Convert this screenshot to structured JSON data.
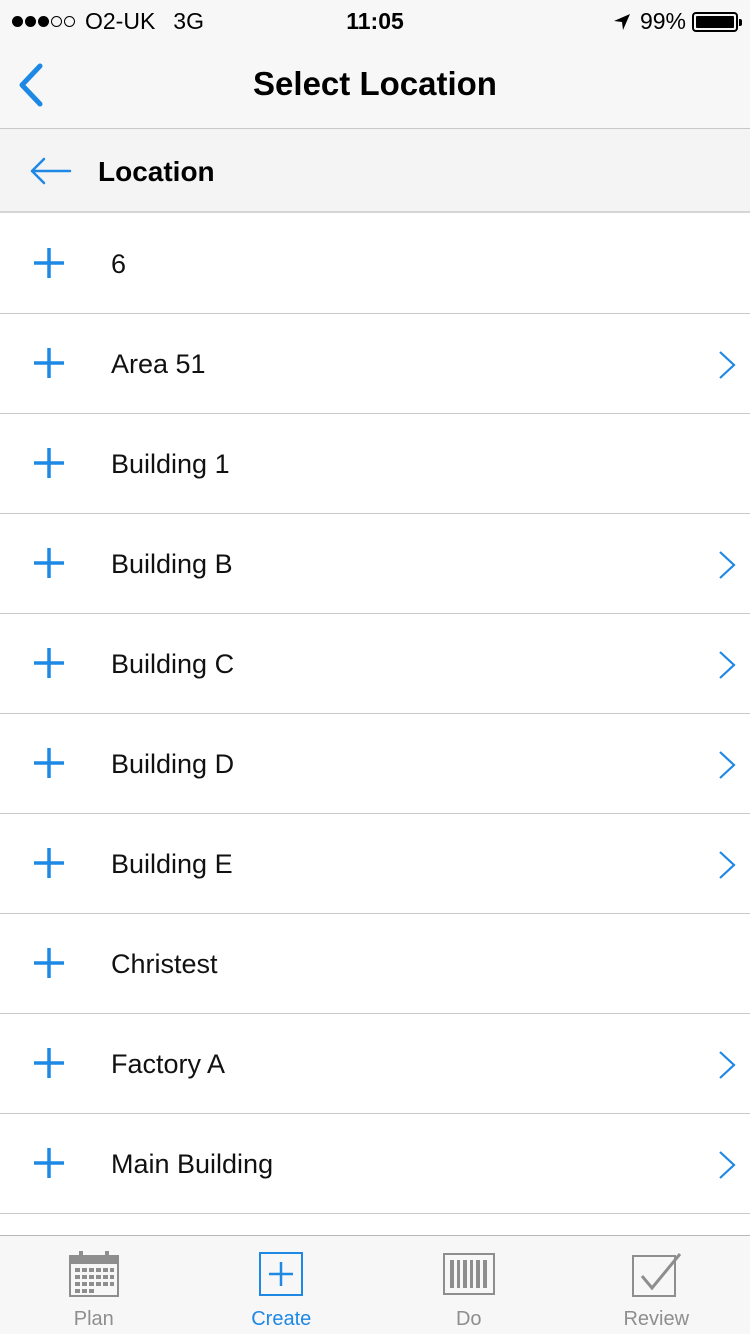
{
  "status_bar": {
    "signal_bars_filled": 3,
    "signal_bars_total": 5,
    "carrier": "O2-UK",
    "network": "3G",
    "time": "11:05",
    "battery": "99%"
  },
  "nav": {
    "title": "Select Location",
    "back_icon": "chevron-left-icon"
  },
  "subheader": {
    "title": "Location",
    "back_icon": "arrow-left-icon"
  },
  "locations": [
    {
      "label": "6",
      "has_children": false
    },
    {
      "label": "Area 51",
      "has_children": true
    },
    {
      "label": "Building 1",
      "has_children": false
    },
    {
      "label": "Building B",
      "has_children": true
    },
    {
      "label": "Building C",
      "has_children": true
    },
    {
      "label": "Building D",
      "has_children": true
    },
    {
      "label": "Building E",
      "has_children": true
    },
    {
      "label": "Christest",
      "has_children": false
    },
    {
      "label": "Factory A",
      "has_children": true
    },
    {
      "label": "Main Building",
      "has_children": true
    }
  ],
  "tabs": [
    {
      "label": "Plan",
      "icon": "calendar-icon",
      "active": false
    },
    {
      "label": "Create",
      "icon": "plus-square-icon",
      "active": true
    },
    {
      "label": "Do",
      "icon": "barcode-icon",
      "active": false
    },
    {
      "label": "Review",
      "icon": "checkbox-icon",
      "active": false
    }
  ],
  "colors": {
    "accent": "#1e88e5",
    "inactive": "#8e8e8e",
    "separator": "#c9c9c9"
  }
}
